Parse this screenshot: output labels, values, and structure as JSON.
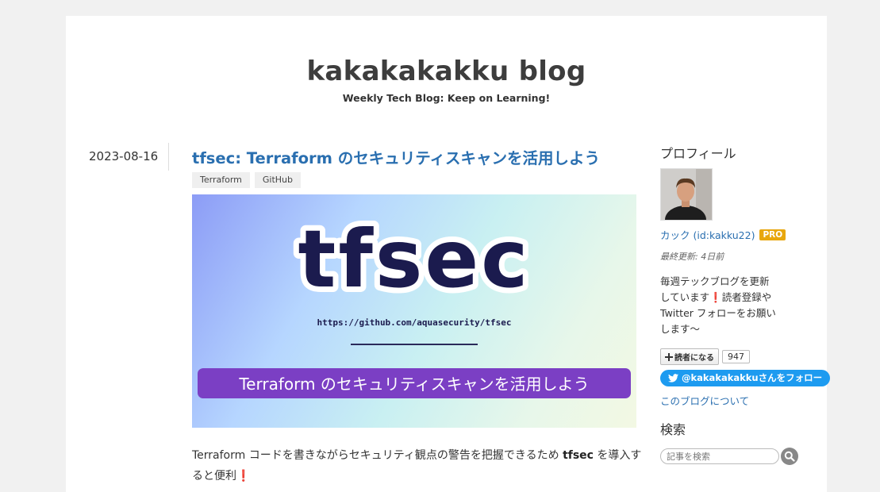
{
  "header": {
    "blog_title": "kakakakakku blog",
    "blog_description": "Weekly Tech Blog: Keep on Learning!"
  },
  "entry": {
    "date": "2023-08-16",
    "title": "tfsec: Terraform のセキュリティスキャンを活用しよう",
    "categories": [
      "Terraform",
      "GitHub"
    ],
    "eyecatch": {
      "big_word": "tfsec",
      "url": "https://github.com/aquasecurity/tfsec",
      "banner": "Terraform のセキュリティスキャンを活用しよう"
    },
    "intro_before": "Terraform コードを書きながらセキュリティ観点の警告を把握できるため ",
    "intro_bold": "tfsec",
    "intro_after": " を導入すると便利",
    "intro_mark": "❗"
  },
  "sidebar": {
    "profile_heading": "プロフィール",
    "profile_name": "カック (id:kakku22)",
    "pro_badge": "PRO",
    "last_updated": "最終更新: 4日前",
    "description_1": "毎週テックブログを更新しています",
    "description_mark": "❗",
    "description_2": "読者登録や Twitter フォローをお願いします〜",
    "subscribe_label": "読者になる",
    "subscriber_count": "947",
    "twitter_follow_label": "@kakakakakkuさんをフォロー",
    "about_link": "このブログについて",
    "search_heading": "検索",
    "search_placeholder": "記事を検索"
  },
  "colors": {
    "link": "#2a6fb0",
    "pro_badge": "#e8a70e",
    "twitter": "#1d9bf0",
    "banner": "#7b3fc4"
  },
  "icons": [
    "plus-icon",
    "twitter-bird-icon",
    "search-icon"
  ]
}
